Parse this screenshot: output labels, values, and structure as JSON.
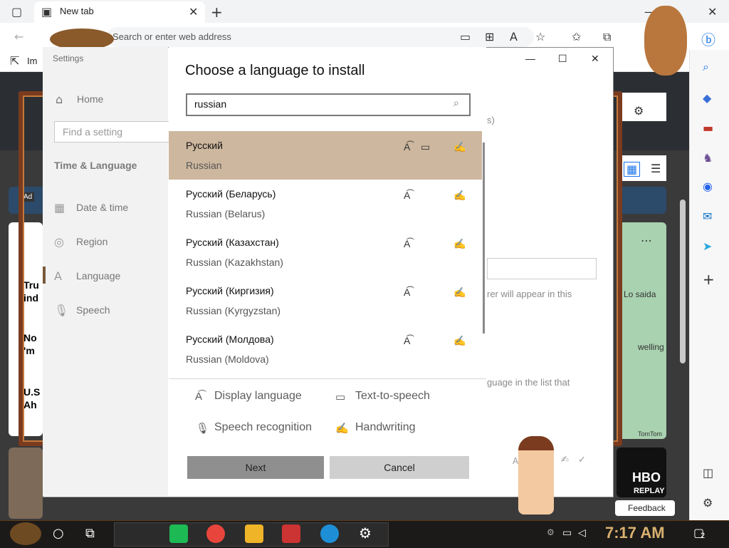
{
  "browser": {
    "tab_title": "New tab",
    "address_placeholder": "Search or enter web address",
    "fav_partial": "Im",
    "feedback_label": "Feedback",
    "ad_label": "Ad",
    "news_snippets": [
      "Tru",
      "ind",
      "No",
      "'m",
      "U.S",
      "Ah"
    ],
    "map_labels": [
      "Lo  saida",
      "welling",
      "TomTom"
    ],
    "hbo_label": "HBO",
    "replay_label": "REPLAY"
  },
  "settings": {
    "window_title": "Settings",
    "nav": {
      "home": "Home",
      "search_placeholder": "Find a setting",
      "section": "Time & Language",
      "items": [
        "Date & time",
        "Region",
        "Language",
        "Speech"
      ]
    },
    "bg_texts": [
      "rer will appear in this",
      "guage in the list that",
      "s)"
    ]
  },
  "dialog": {
    "title": "Choose a language to install",
    "search_value": "russian",
    "languages": [
      {
        "native": "Русский",
        "english": "Russian",
        "selected": true,
        "tts": true
      },
      {
        "native": "Русский (Беларусь)",
        "english": "Russian (Belarus)",
        "selected": false,
        "tts": false
      },
      {
        "native": "Русский (Казахстан)",
        "english": "Russian (Kazakhstan)",
        "selected": false,
        "tts": false
      },
      {
        "native": "Русский (Киргизия)",
        "english": "Russian (Kyrgyzstan)",
        "selected": false,
        "tts": false
      },
      {
        "native": "Русский (Молдова)",
        "english": "Russian (Moldova)",
        "selected": false,
        "tts": false
      }
    ],
    "legend": {
      "display": "Display language",
      "tts": "Text-to-speech",
      "speech": "Speech recognition",
      "handwriting": "Handwriting"
    },
    "next_label": "Next",
    "cancel_label": "Cancel"
  },
  "taskbar": {
    "time": "7:17 AM",
    "notification_count": "2"
  },
  "colors": {
    "selected_row": "#cdb79e",
    "frame": "#7a3b1f",
    "clock": "#d8b070"
  }
}
